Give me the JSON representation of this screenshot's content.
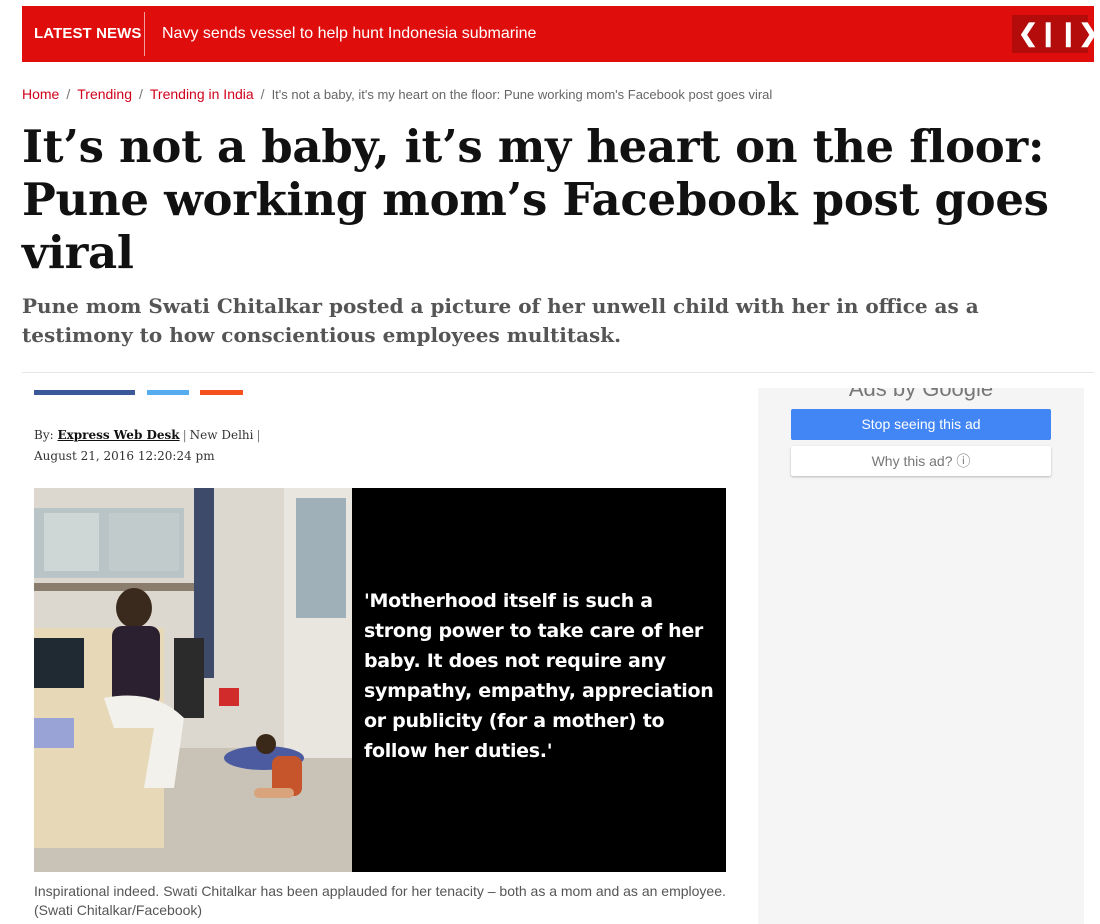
{
  "ticker": {
    "label": "LATEST NEWS",
    "headline": "Navy sends vessel to help hunt Indonesia submarine",
    "prev_icon": "❮",
    "pause_icon": "❙❙",
    "next_icon": "❯",
    "color": "#e00d0d"
  },
  "breadcrumb": {
    "items": [
      "Home",
      "Trending",
      "Trending in India"
    ],
    "separator": "/",
    "current": "It's not a baby, it's my heart on the floor: Pune working mom's Facebook post goes viral"
  },
  "article": {
    "title": "It’s not a baby, it’s my heart on the floor: Pune working mom’s Facebook post goes viral",
    "subtitle": "Pune mom Swati Chitalkar posted a picture of her unwell child with her in office as a testimony to how conscientious employees multitask.",
    "byline": {
      "prefix": "By:",
      "author": "Express Web Desk",
      "location": "New Delhi",
      "date": "August 21, 2016 12:20:24 pm"
    },
    "image": {
      "quote": "'Motherhood itself is such a strong power to take care of her baby. It does not require any sympathy, empathy, appreciation or publicity (for a mother) to follow her duties.'"
    },
    "caption": "Inspirational indeed. Swati Chitalkar has been applauded for her tenacity – both as a mom and as an employee. (Swati Chitalkar/Facebook)"
  },
  "share_colors": {
    "facebook": "#3b5998",
    "twitter": "#55acee",
    "googleplus": "#f4511e"
  },
  "ad": {
    "ads_by": "Ads by Google",
    "stop_label": "Stop seeing this ad",
    "why_label": "Why this ad? ⓘ"
  }
}
